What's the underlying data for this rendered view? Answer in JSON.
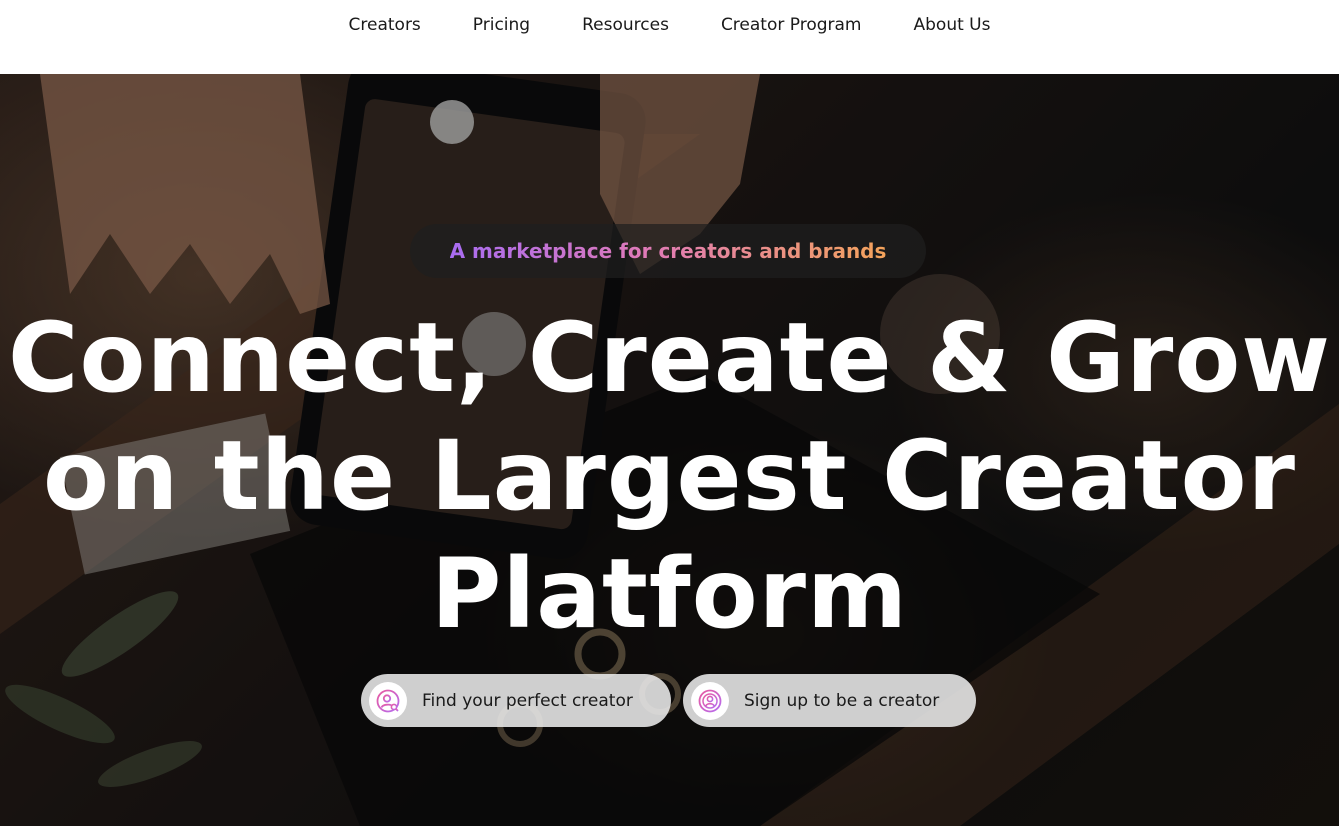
{
  "nav": {
    "items": [
      {
        "label": "Creators"
      },
      {
        "label": "Pricing"
      },
      {
        "label": "Resources"
      },
      {
        "label": "Creator Program"
      },
      {
        "label": "About Us"
      }
    ]
  },
  "hero": {
    "tagline": "A marketplace for creators and brands",
    "headline_lines": [
      "Connect, Create & Grow",
      "on the Largest Creator",
      "Platform"
    ],
    "cta_primary": {
      "label": "Find your perfect creator",
      "icon": "user-search-icon"
    },
    "cta_secondary": {
      "label": "Sign up to be a creator",
      "icon": "creator-signup-icon"
    }
  },
  "colors": {
    "tagline_gradient": [
      "#a86cf2",
      "#e07ab8",
      "#f4a35a"
    ],
    "headline": "#ffffff",
    "nav_text": "#1a1a1a",
    "icon_gradient": [
      "#e85aa0",
      "#b66cf0"
    ]
  }
}
